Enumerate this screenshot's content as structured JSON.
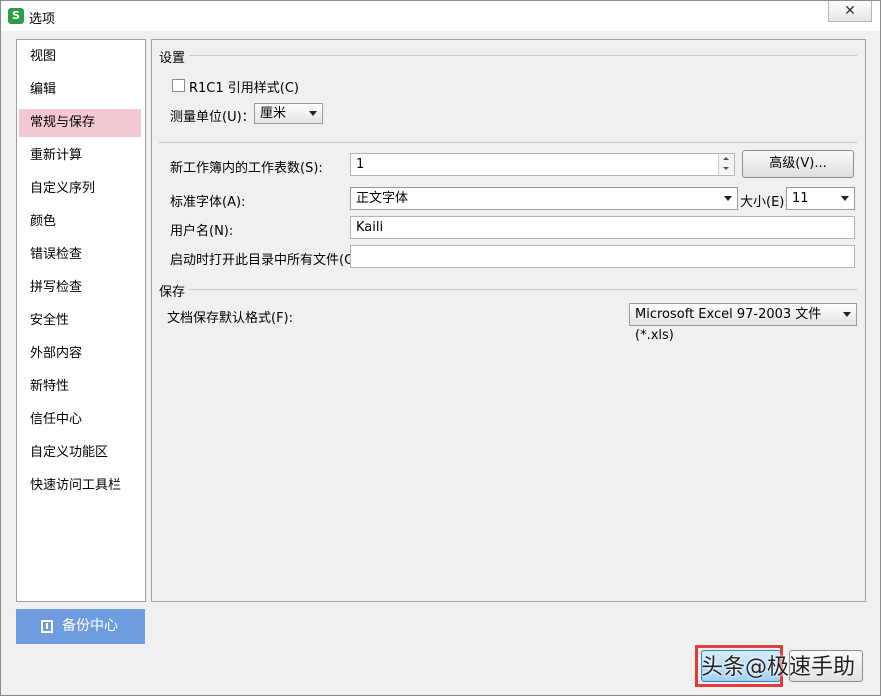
{
  "window": {
    "title": "选项",
    "logo": "S",
    "close": "✕"
  },
  "sidebar": {
    "items": [
      {
        "label": "视图"
      },
      {
        "label": "编辑"
      },
      {
        "label": "常规与保存",
        "active": true
      },
      {
        "label": "重新计算"
      },
      {
        "label": "自定义序列"
      },
      {
        "label": "颜色"
      },
      {
        "label": "错误检查"
      },
      {
        "label": "拼写检查"
      },
      {
        "label": "安全性"
      },
      {
        "label": "外部内容"
      },
      {
        "label": "新特性"
      },
      {
        "label": "信任中心"
      },
      {
        "label": "自定义功能区"
      },
      {
        "label": "快速访问工具栏"
      }
    ],
    "backup_label": "备份中心"
  },
  "settings": {
    "section": "设置",
    "r1c1_label": "R1C1 引用样式(C)",
    "r1c1_checked": false,
    "unit_label": "测量单位(U)：",
    "unit_value": "厘米",
    "sheets_label": "新工作簿内的工作表数(S):",
    "sheets_value": "1",
    "advanced_label": "高级(V)...",
    "font_label": "标准字体(A):",
    "font_value": "正文字体",
    "size_label": "大小(E):",
    "size_value": "11",
    "username_label": "用户名(N):",
    "username_value": "Kaili",
    "startup_label": "启动时打开此目录中所有文件(O):",
    "startup_value": ""
  },
  "save": {
    "section": "保存",
    "format_label": "文档保存默认格式(F):",
    "format_value": "Microsoft Excel 97-2003 文件(*.xls)"
  },
  "watermark": "头条@极速手助",
  "colors": {
    "active_item": "#f3c8d3",
    "backup_button": "#6d9ddf",
    "highlight": "#e53b3b"
  }
}
